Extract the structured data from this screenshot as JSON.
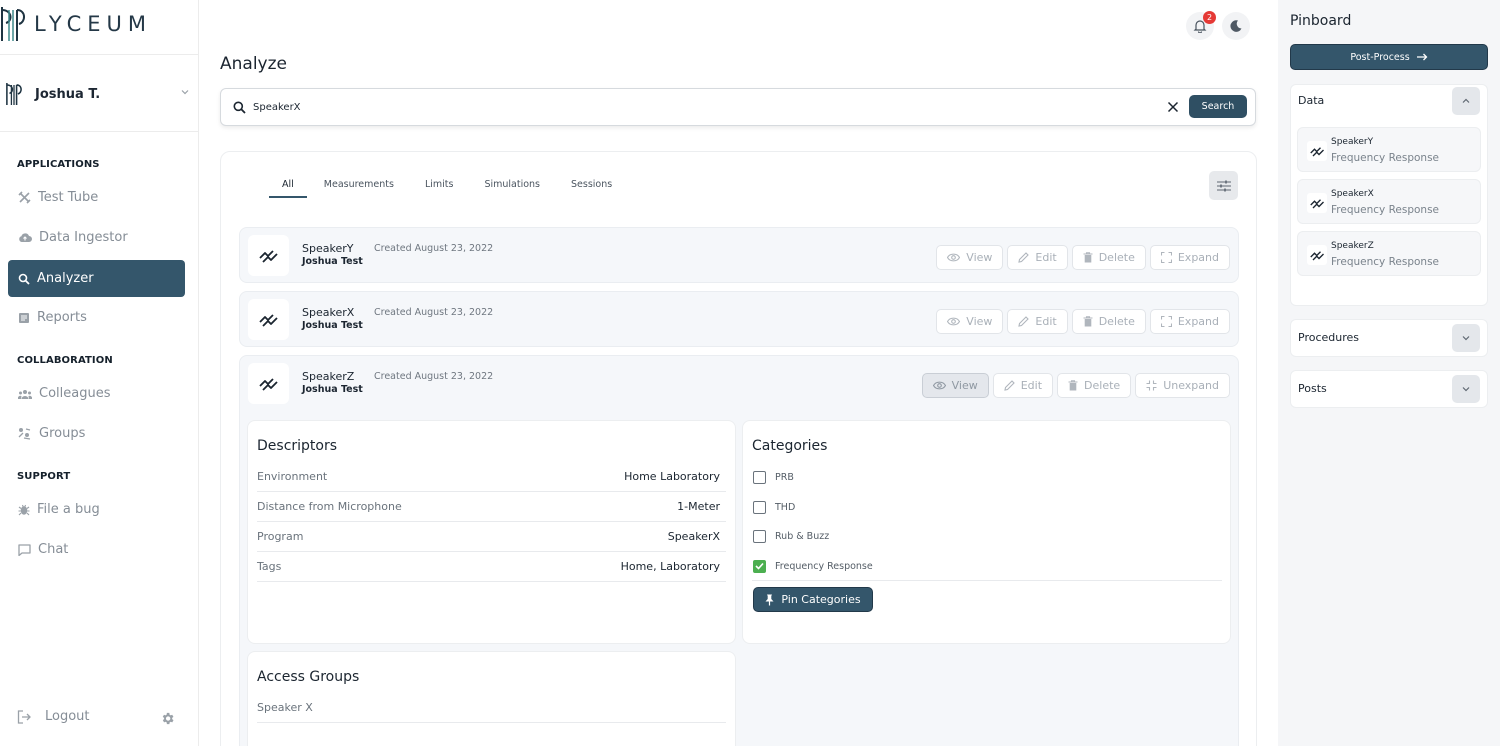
{
  "app": {
    "logo_text": "LYCEUM"
  },
  "user": {
    "name": "Joshua T."
  },
  "sidebar": {
    "sections": [
      {
        "title": "APPLICATIONS",
        "items": [
          {
            "label": "Test Tube",
            "icon": "test-tube-icon"
          },
          {
            "label": "Data Ingestor",
            "icon": "cloud-upload-icon"
          },
          {
            "label": "Analyzer",
            "icon": "search-icon",
            "active": true
          },
          {
            "label": "Reports",
            "icon": "report-icon"
          }
        ]
      },
      {
        "title": "COLLABORATION",
        "items": [
          {
            "label": "Colleagues",
            "icon": "people-icon"
          },
          {
            "label": "Groups",
            "icon": "groups-icon"
          }
        ]
      },
      {
        "title": "SUPPORT",
        "items": [
          {
            "label": "File a bug",
            "icon": "bug-icon"
          },
          {
            "label": "Chat",
            "icon": "chat-icon"
          }
        ]
      }
    ],
    "logout_label": "Logout"
  },
  "header": {
    "notification_count": "2"
  },
  "page": {
    "title": "Analyze"
  },
  "search": {
    "value": "SpeakerX",
    "button_label": "Search"
  },
  "tabs": [
    "All",
    "Measurements",
    "Limits",
    "Simulations",
    "Sessions"
  ],
  "active_tab": "All",
  "actions": {
    "view": "View",
    "edit": "Edit",
    "delete": "Delete",
    "expand": "Expand",
    "unexpand": "Unexpand"
  },
  "results": [
    {
      "name": "SpeakerY",
      "owner": "Joshua Test",
      "created": "Created August 23, 2022"
    },
    {
      "name": "SpeakerX",
      "owner": "Joshua Test",
      "created": "Created August 23, 2022"
    },
    {
      "name": "SpeakerZ",
      "owner": "Joshua Test",
      "created": "Created August 23, 2022",
      "expanded": true
    }
  ],
  "details": {
    "descriptors_title": "Descriptors",
    "descriptors": [
      {
        "key": "Environment",
        "value": "Home Laboratory"
      },
      {
        "key": "Distance from Microphone",
        "value": "1-Meter"
      },
      {
        "key": "Program",
        "value": "SpeakerX"
      },
      {
        "key": "Tags",
        "value": "Home, Laboratory"
      }
    ],
    "categories_title": "Categories",
    "categories": [
      {
        "label": "PRB",
        "checked": false
      },
      {
        "label": "THD",
        "checked": false
      },
      {
        "label": "Rub & Buzz",
        "checked": false
      },
      {
        "label": "Frequency Response",
        "checked": true
      }
    ],
    "pin_button": "Pin Categories",
    "access_title": "Access Groups",
    "access_groups": [
      "Speaker X"
    ]
  },
  "pinboard": {
    "title": "Pinboard",
    "post_process": "Post-Process",
    "data_title": "Data",
    "data_items": [
      {
        "name": "SpeakerY",
        "type": "Frequency Response"
      },
      {
        "name": "SpeakerX",
        "type": "Frequency Response"
      },
      {
        "name": "SpeakerZ",
        "type": "Frequency Response"
      }
    ],
    "procedures_title": "Procedures",
    "posts_title": "Posts"
  },
  "colors": {
    "primary": "#34566b",
    "accent_dark": "#2f4f63",
    "badge": "#e53935",
    "check": "#4caf50"
  }
}
